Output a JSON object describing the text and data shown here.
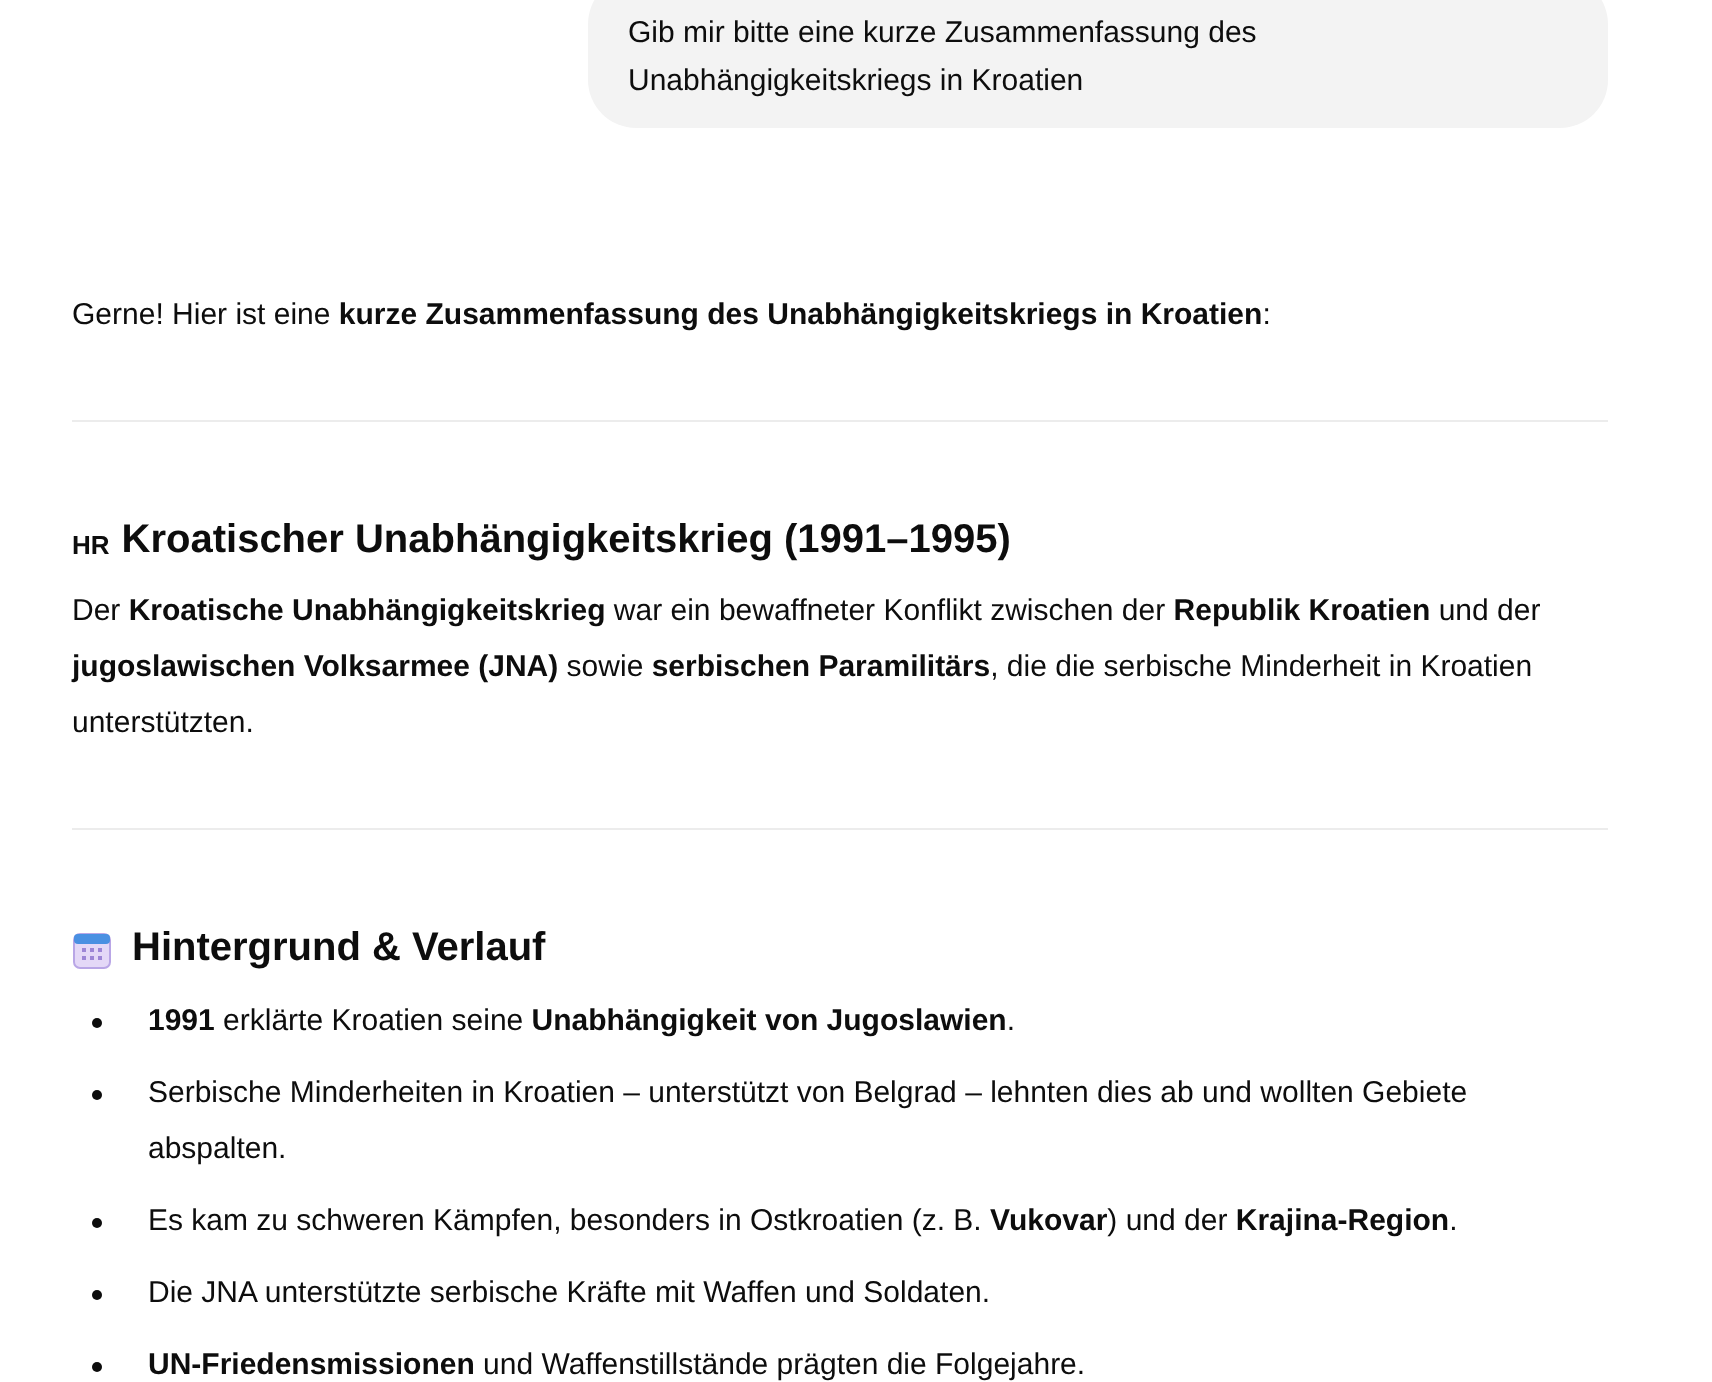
{
  "user_message": "Gib mir bitte eine kurze Zusammenfassung des Unabhängigkeitskriegs in Kroatien",
  "intro": "Gerne! Hier ist eine **kurze Zusammenfassung des Unabhängigkeitskriegs in Kroatien**:",
  "sections": [
    {
      "kind": "flag",
      "flag": "HR",
      "title": "Kroatischer Unabhängigkeitskrieg (1991–1995)",
      "paragraph": "Der **Kroatische Unabhängigkeitskrieg** war ein bewaffneter Konflikt zwischen der **Republik Kroatien** und der **jugoslawischen Volksarmee (JNA)** sowie **serbischen Paramilitärs**, die die serbische Minderheit in Kroatien unterstützten."
    },
    {
      "kind": "icon",
      "title": "Hintergrund & Verlauf",
      "bullets": [
        "**1991** erklärte Kroatien seine **Unabhängigkeit von Jugoslawien**.",
        "Serbische Minderheiten in Kroatien – unterstützt von Belgrad – lehnten dies ab und wollten Gebiete abspalten.",
        "Es kam zu schweren Kämpfen, besonders in Ostkroatien (z. B. **Vukovar**) und der **Krajina-Region**.",
        "Die JNA unterstützte serbische Kräfte mit Waffen und Soldaten.",
        "**UN-Friedensmissionen** und Waffenstillstände prägten die Folgejahre."
      ]
    }
  ]
}
